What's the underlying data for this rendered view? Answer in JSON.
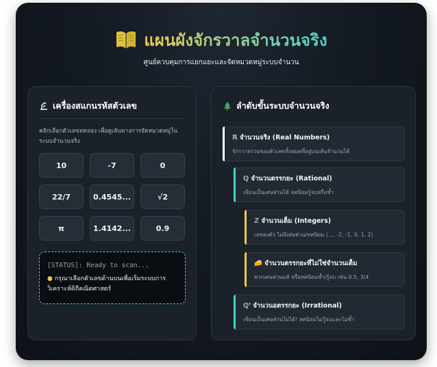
{
  "header": {
    "title": "แผนผังจักรวาลจำนวนจริง",
    "subtitle": "ศูนย์ควบคุมการแยกแยะและจัดหมวดหมู่ระบบจำนวน"
  },
  "scanner": {
    "heading": "เครื่องสแกนรหัสตัวเลข",
    "hint": "คลิกเลือกตัวเลขทดลอง เพื่อดูเส้นทางการจัดหมวดหมู่ในระบบจำนวนจริง",
    "keys": [
      "10",
      "-7",
      "0",
      "22/7",
      "0.4545...",
      "√2",
      "π",
      "1.4142...",
      "0.9"
    ],
    "status_line": "[STATUS]: Ready to scan...",
    "status_message": "กรุณาเลือกตัวเลขด้านบนเพื่อเริ่มระบบการวิเคราะห์ดิถีคณิตศาสตร์"
  },
  "hierarchy": {
    "heading": "ลำดับขั้นระบบจำนวนจริง",
    "items": [
      {
        "symbol": "ℝ",
        "name": "จำนวนจริง (Real Numbers)",
        "desc": "จักรวาลรวมของตัวเลขทั้งหมดที่อยู่บนเส้นจำนวนได้",
        "color": "#ffffff"
      },
      {
        "symbol": "ℚ",
        "name": "จำนวนตรรกยะ (Rational)",
        "desc": "เขียนเป็นเศษส่วนได้ ทศนิยมรู้จบหรือซ้ำ",
        "color": "#3dd6d0"
      },
      {
        "symbol": "ℤ",
        "name": "จำนวนเต็ม (Integers)",
        "desc": "เลขลงตัว ไม่มีเศษส่วน/ทศนิยม (..., -2, -1, 0, 1, 2)",
        "color": "#f2c94c"
      },
      {
        "symbol": "🧀",
        "name": "จำนวนตรรกยะที่ไม่ใช่จำนวนเต็ม",
        "desc": "พวกเศษส่วนแท้ หรือทศนิยมซ้ำ/รู้จบ เช่น 0.5, 3/4",
        "color": "#f2c94c"
      },
      {
        "symbol": "ℚ'",
        "name": "จำนวนอตรรกยะ (Irrational)",
        "desc": "เขียนเป็นเศษส่วนไม่ได้! ทศนิยมไม่รู้จบและไม่ซ้ำ",
        "color": "#3dd6d0"
      }
    ]
  }
}
